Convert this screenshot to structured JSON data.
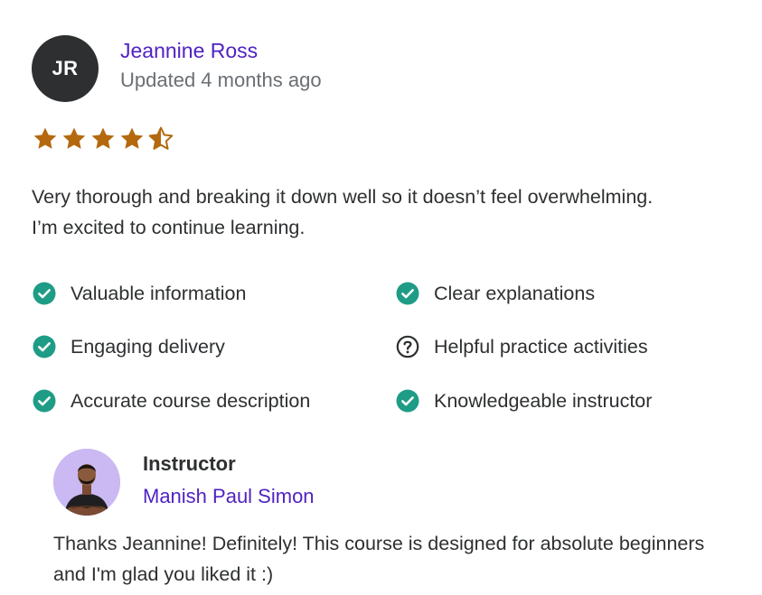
{
  "review": {
    "avatar_initials": "JR",
    "reviewer_name": "Jeannine Ross",
    "updated": "Updated 4 months ago",
    "rating": 4.5,
    "rating_max": 5,
    "star_color": "#b4690e",
    "text": "Very thorough and breaking it down well so it doesn’t feel overwhelming. I’m excited to continue learning."
  },
  "tags": [
    {
      "label": "Valuable information",
      "icon": "check-circle-icon"
    },
    {
      "label": "Clear explanations",
      "icon": "check-circle-icon"
    },
    {
      "label": "Engaging delivery",
      "icon": "check-circle-icon"
    },
    {
      "label": "Helpful practice activities",
      "icon": "question-circle-icon"
    },
    {
      "label": "Accurate course description",
      "icon": "check-circle-icon"
    },
    {
      "label": "Knowledgeable instructor",
      "icon": "check-circle-icon"
    }
  ],
  "colors": {
    "check": "#1e9c86",
    "link": "#5022c3",
    "muted": "#6a6f73",
    "text": "#2d2f31"
  },
  "instructor": {
    "role": "Instructor",
    "name": "Manish Paul Simon",
    "reply": "Thanks Jeannine! Definitely! This course is designed for absolute beginners and I'm glad you liked it :)"
  }
}
